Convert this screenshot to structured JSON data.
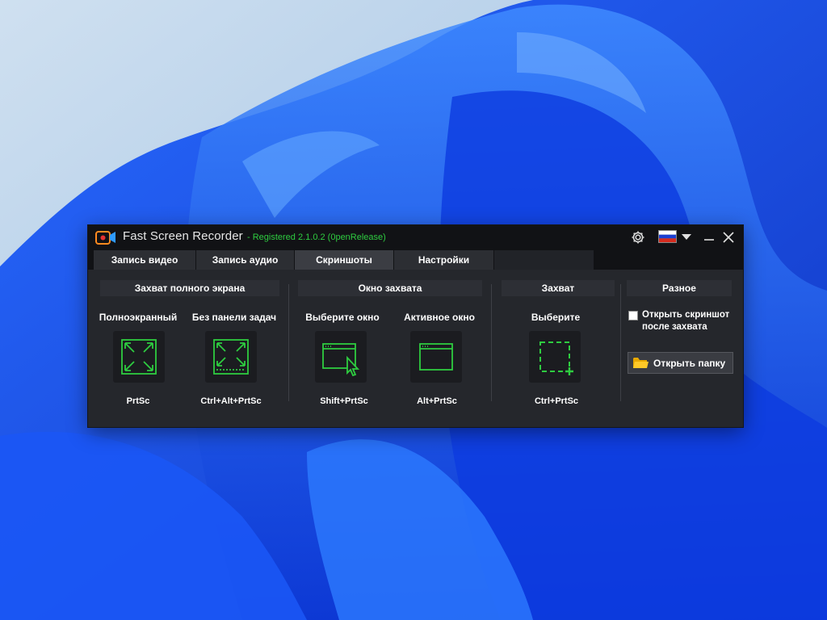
{
  "window": {
    "title": "Fast Screen Recorder",
    "registered": "- Registered 2.1.0.2 (0penRelease)"
  },
  "tabs": [
    {
      "label": "Запись видео",
      "active": false
    },
    {
      "label": "Запись аудио",
      "active": false
    },
    {
      "label": "Скриншоты",
      "active": true
    },
    {
      "label": "Настройки",
      "active": false
    }
  ],
  "sections": {
    "fullscreen": {
      "header": "Захват полного экрана",
      "options": [
        {
          "label": "Полноэкранный",
          "hotkey": "PrtSc",
          "icon": "fullscreen-expand-icon"
        },
        {
          "label": "Без панели задач",
          "hotkey": "Ctrl+Alt+PrtSc",
          "icon": "fullscreen-no-taskbar-icon"
        }
      ]
    },
    "window": {
      "header": "Окно захвата",
      "options": [
        {
          "label": "Выберите окно",
          "hotkey": "Shift+PrtSc",
          "icon": "window-select-icon"
        },
        {
          "label": "Активное окно",
          "hotkey": "Alt+PrtSc",
          "icon": "active-window-icon"
        }
      ]
    },
    "region": {
      "header": "Захват",
      "options": [
        {
          "label": "Выберите",
          "hotkey": "Ctrl+PrtSc",
          "icon": "region-select-icon"
        }
      ]
    },
    "misc": {
      "header": "Разное",
      "checkbox_label": "Открыть скриншот после захвата",
      "checkbox_checked": false,
      "open_folder_label": "Открыть папку"
    }
  },
  "colors": {
    "accent_green": "#2ecc40",
    "titlebar": "#111215",
    "panel": "#25272c"
  }
}
